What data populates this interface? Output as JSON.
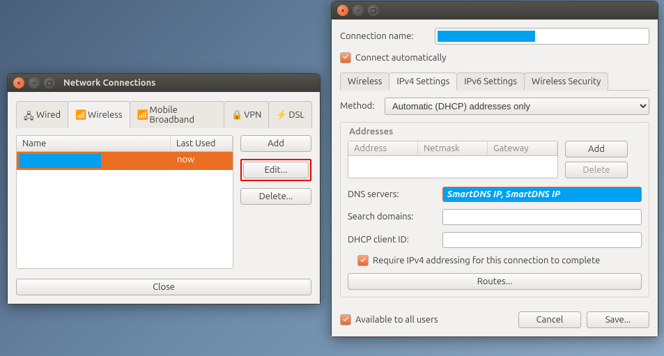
{
  "win_a": {
    "title": "Network Connections",
    "tabs": [
      "Wired",
      "Wireless",
      "Mobile Broadband",
      "VPN",
      "DSL"
    ],
    "active_tab": 1,
    "table": {
      "headers": [
        "Name",
        "Last Used"
      ],
      "row_last_used": "now"
    },
    "buttons": {
      "add": "Add",
      "edit": "Edit...",
      "delete": "Delete...",
      "close": "Close"
    }
  },
  "win_b": {
    "conn_name_label": "Connection name:",
    "connect_auto": "Connect automatically",
    "tabs": [
      "Wireless",
      "IPv4 Settings",
      "IPv6 Settings",
      "Wireless Security"
    ],
    "active_tab": 1,
    "method_label": "Method:",
    "method_value": "Automatic (DHCP) addresses only",
    "addresses_title": "Addresses",
    "addr_headers": [
      "Address",
      "Netmask",
      "Gateway"
    ],
    "addr_buttons": {
      "add": "Add",
      "delete": "Delete"
    },
    "dns_label": "DNS servers:",
    "dns_value": "SmartDNS IP, SmartDNS IP",
    "search_label": "Search domains:",
    "search_value": "",
    "dhcp_label": "DHCP client ID:",
    "dhcp_value": "",
    "require_ipv4": "Require IPv4 addressing for this connection to complete",
    "routes": "Routes...",
    "available_all": "Available to all users",
    "cancel": "Cancel",
    "save": "Save..."
  }
}
